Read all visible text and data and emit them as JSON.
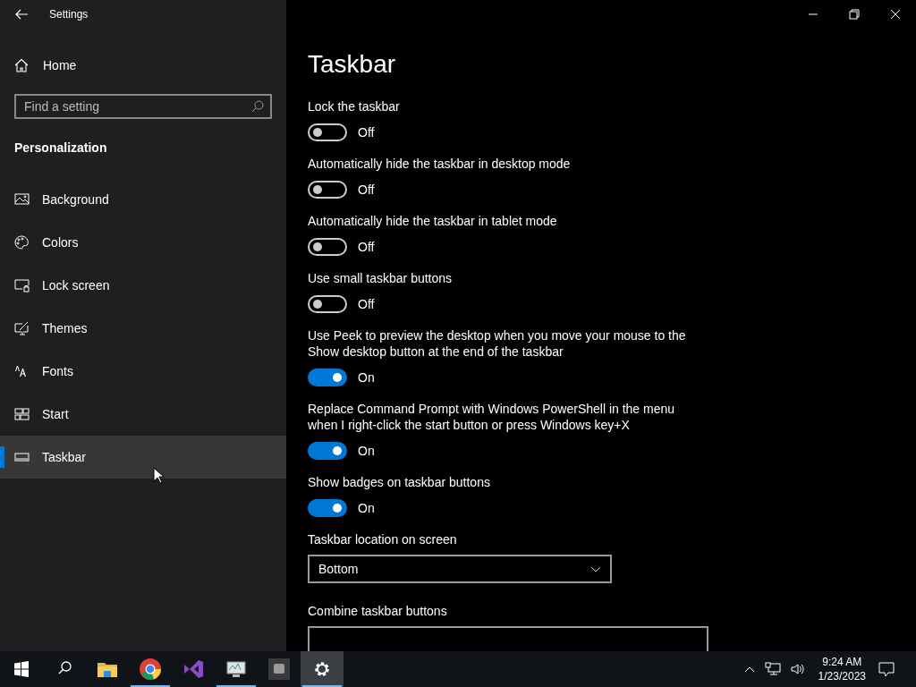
{
  "window": {
    "title": "Settings"
  },
  "sidebar": {
    "home": "Home",
    "search": {
      "placeholder": "Find a setting"
    },
    "section": "Personalization",
    "items": [
      {
        "label": "Background",
        "selected": false
      },
      {
        "label": "Colors",
        "selected": false
      },
      {
        "label": "Lock screen",
        "selected": false
      },
      {
        "label": "Themes",
        "selected": false
      },
      {
        "label": "Fonts",
        "selected": false
      },
      {
        "label": "Start",
        "selected": false
      },
      {
        "label": "Taskbar",
        "selected": true
      }
    ]
  },
  "page": {
    "title": "Taskbar",
    "settings": [
      {
        "kind": "toggle",
        "label": "Lock the taskbar",
        "on": false,
        "state": "Off"
      },
      {
        "kind": "toggle",
        "label": "Automatically hide the taskbar in desktop mode",
        "on": false,
        "state": "Off"
      },
      {
        "kind": "toggle",
        "label": "Automatically hide the taskbar in tablet mode",
        "on": false,
        "state": "Off"
      },
      {
        "kind": "toggle",
        "label": "Use small taskbar buttons",
        "on": false,
        "state": "Off"
      },
      {
        "kind": "toggle",
        "label": "Use Peek to preview the desktop when you move your mouse to the Show desktop button at the end of the taskbar",
        "on": true,
        "state": "On"
      },
      {
        "kind": "toggle",
        "label": "Replace Command Prompt with Windows PowerShell in the menu when I right-click the start button or press Windows key+X",
        "on": true,
        "state": "On"
      },
      {
        "kind": "toggle",
        "label": "Show badges on taskbar buttons",
        "on": true,
        "state": "On"
      },
      {
        "kind": "dropdown",
        "label": "Taskbar location on screen",
        "value": "Bottom"
      },
      {
        "kind": "dropdown",
        "label": "Combine taskbar buttons"
      }
    ]
  },
  "taskbar": {
    "apps": [
      {
        "running": false,
        "selected": false
      },
      {
        "running": true,
        "selected": false
      },
      {
        "running": false,
        "selected": false
      },
      {
        "running": true,
        "selected": false
      },
      {
        "running": false,
        "selected": false
      },
      {
        "running": true,
        "selected": true
      }
    ],
    "time": "9:24 AM",
    "date": "1/23/2023"
  }
}
